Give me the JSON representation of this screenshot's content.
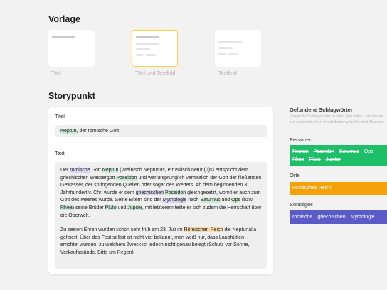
{
  "template_section": {
    "heading": "Vorlage",
    "templates": [
      {
        "label": "Titel",
        "selected": false
      },
      {
        "label": "Titel und Textfeld",
        "selected": true
      },
      {
        "label": "Textfeld",
        "selected": false
      }
    ]
  },
  "story_section": {
    "heading": "Storypunkt",
    "title_label": "Titel",
    "title_value": {
      "highlight": "Neptun",
      "rest": ", der römische Gott"
    },
    "text_label": "Text",
    "paragraphs": [
      [
        {
          "t": "Der "
        },
        {
          "t": "römische",
          "c": "s"
        },
        {
          "t": " Gott "
        },
        {
          "t": "Neptun",
          "c": "p"
        },
        {
          "t": " (lateinisch Neptūnus, etruskisch netun(u)s) entspricht dem griechischen Wassergott "
        },
        {
          "t": "Poseidon",
          "c": "p"
        },
        {
          "t": " und war ursprünglich vermutlich der Gott der fließenden Gewässer, der springenden Quellen oder sogar des Wetters. Ab dem beginnenden 3. Jahrhundert v. Chr. wurde er dem "
        },
        {
          "t": "griechischen",
          "c": "s"
        },
        {
          "t": " "
        },
        {
          "t": "Poseidon",
          "c": "p"
        },
        {
          "t": " gleichgesetzt, womit er auch zum Gott des Meeres wurde. Seine Eltern sind der "
        },
        {
          "t": "Mythologie",
          "c": "s"
        },
        {
          "t": " nach "
        },
        {
          "t": "Saturnus",
          "c": "p"
        },
        {
          "t": " und "
        },
        {
          "t": "Ops",
          "c": "p"
        },
        {
          "t": " (bzw. "
        },
        {
          "t": "Rhea",
          "c": "p"
        },
        {
          "t": ") seine Brüder "
        },
        {
          "t": "Pluto",
          "c": "p"
        },
        {
          "t": " und "
        },
        {
          "t": "Jupiter",
          "c": "p"
        },
        {
          "t": ", mit letzterem teilte er sich zudem die Herrschaft über die Oberwelt."
        }
      ],
      [
        {
          "t": "Zu seinen Ehren wurden schon sehr früh am 23. Juli im "
        },
        {
          "t": "Römischen Reich",
          "c": "o"
        },
        {
          "t": " die Neptunalia gefeiert. Über das Fest selbst ist nicht viel bekannt, man weiß nur, dass Laubhütten errichtet wurden, zu welchem Zweck ist jedoch nicht genau belegt (Schutz vor Sonne, Verkaufsstände, Bitte um Regen)."
        }
      ]
    ]
  },
  "keywords_panel": {
    "title": "Gefundene Schlagwörter",
    "description": "Folgende Schlagwörter wurden gefunden und dienen zur automatischen Inhaltsfindung im Content-Browser",
    "groups": [
      {
        "label": "Personen",
        "color": "#1fbf6a",
        "chips": [
          {
            "label": "Neptun",
            "strike": true
          },
          {
            "label": "Poseidon",
            "strike": true
          },
          {
            "label": "Saturnus",
            "strike": true
          },
          {
            "label": "Ops",
            "strike": false
          },
          {
            "label": "Rhea",
            "strike": true
          },
          {
            "label": "Pluto",
            "strike": true
          },
          {
            "label": "Jupiter",
            "strike": true
          }
        ]
      },
      {
        "label": "Orte",
        "color": "#f5a20a",
        "chips": [
          {
            "label": "Römisches Reich",
            "strike": false
          }
        ]
      },
      {
        "label": "Sonstiges",
        "color": "#5a5bc8",
        "chips": [
          {
            "label": "römische",
            "strike": false
          },
          {
            "label": "griechischen",
            "strike": false
          },
          {
            "label": "Mythologie",
            "strike": false
          }
        ]
      }
    ]
  }
}
